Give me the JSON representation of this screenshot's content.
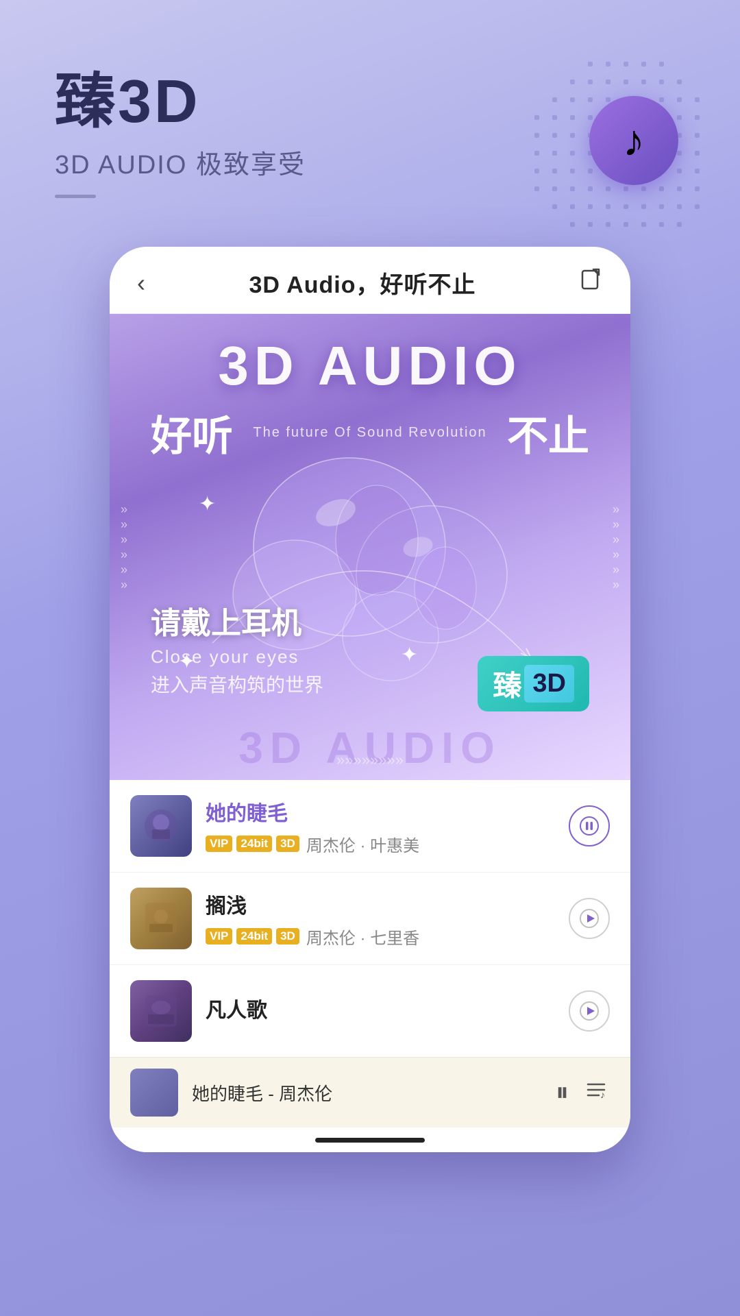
{
  "page": {
    "background_gradient": "linear-gradient(160deg, #c8c8f0 0%, #a0a0e8 40%, #9090d8 100%)"
  },
  "header": {
    "title": "臻3D",
    "subtitle": "3D AUDIO 极致享受",
    "music_icon": "♪"
  },
  "phone": {
    "nav": {
      "back_icon": "‹",
      "title": "3D Audio，好听不止",
      "share_icon": "⬡"
    },
    "banner": {
      "main_text": "3D AUDIO",
      "left_text": "好听",
      "right_text": "不止",
      "future_text": "The future Of Sound Revolution",
      "headphone_text": "请戴上耳机",
      "close_eyes": "Close your eyes",
      "enter_world": "进入声音构筑的世界",
      "zhen3d_label": "臻",
      "zhen3d_3d": "3D",
      "watermark": "3D AUDIO"
    },
    "songs": [
      {
        "id": 1,
        "title": "她的睫毛",
        "tags": [
          "VIP",
          "24bit",
          "3D"
        ],
        "artist": "周杰伦 · 叶惠美",
        "playing": true,
        "thumb_class": "thumb-1"
      },
      {
        "id": 2,
        "title": "搁浅",
        "tags": [
          "VIP",
          "24bit",
          "3D"
        ],
        "artist": "周杰伦 · 七里香",
        "playing": false,
        "thumb_class": "thumb-2"
      },
      {
        "id": 3,
        "title": "凡人歌",
        "tags": [],
        "artist": "",
        "playing": false,
        "thumb_class": "thumb-3"
      }
    ],
    "now_playing": {
      "title": "她的睫毛 - 周杰伦",
      "pause_icon": "⏸",
      "list_icon": "≡♪"
    }
  }
}
